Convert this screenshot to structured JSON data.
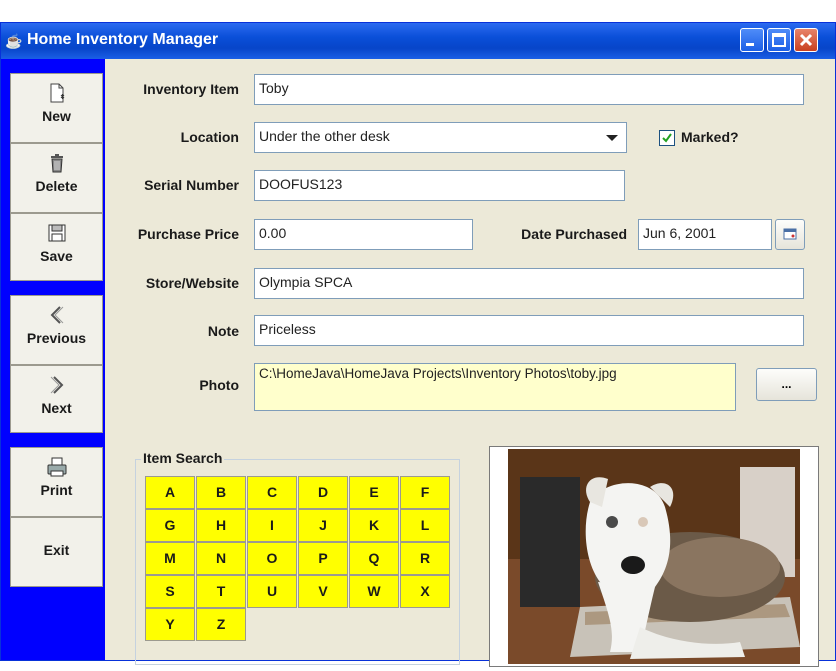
{
  "window": {
    "title": "Home Inventory Manager"
  },
  "sidebar": {
    "new_label": "New",
    "delete_label": "Delete",
    "save_label": "Save",
    "previous_label": "Previous",
    "next_label": "Next",
    "print_label": "Print",
    "exit_label": "Exit"
  },
  "form": {
    "inventory_item": {
      "label": "Inventory Item",
      "value": "Toby"
    },
    "location": {
      "label": "Location",
      "value": "Under the other desk"
    },
    "marked": {
      "label": "Marked?",
      "checked": true
    },
    "serial_number": {
      "label": "Serial Number",
      "value": "DOOFUS123"
    },
    "purchase_price": {
      "label": "Purchase Price",
      "value": "0.00"
    },
    "date_purchased": {
      "label": "Date Purchased",
      "value": "Jun 6, 2001"
    },
    "store_website": {
      "label": "Store/Website",
      "value": "Olympia SPCA"
    },
    "note": {
      "label": "Note",
      "value": "Priceless"
    },
    "photo": {
      "label": "Photo",
      "value": "C:\\HomeJava\\HomeJava Projects\\Inventory Photos\\toby.jpg",
      "browse_label": "..."
    }
  },
  "item_search": {
    "title": "Item Search",
    "letters": [
      "A",
      "B",
      "C",
      "D",
      "E",
      "F",
      "G",
      "H",
      "I",
      "J",
      "K",
      "L",
      "M",
      "N",
      "O",
      "P",
      "Q",
      "R",
      "S",
      "T",
      "U",
      "V",
      "W",
      "X",
      "Y",
      "Z"
    ]
  },
  "photo_preview": {
    "subject": "dog-photo"
  }
}
